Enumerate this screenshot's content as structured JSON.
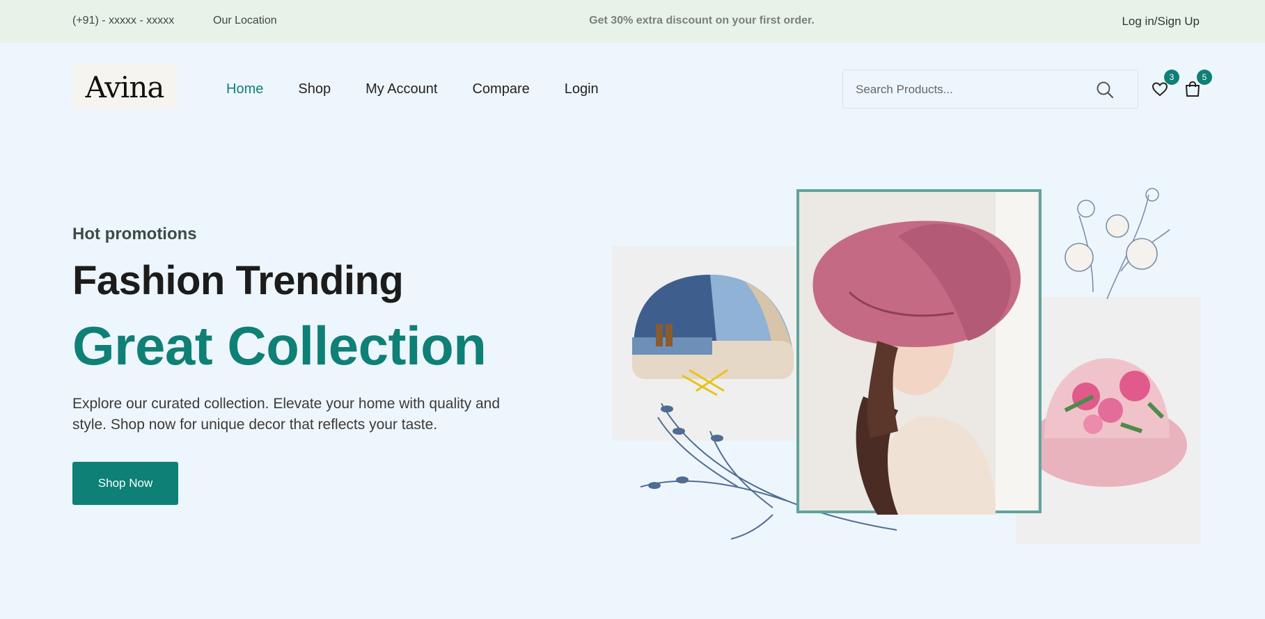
{
  "topbar": {
    "phone": "(+91) - xxxxx - xxxxx",
    "location": "Our Location",
    "promo": "Get 30% extra discount on your first order.",
    "login": "Log in/Sign Up"
  },
  "header": {
    "logo": "Avina",
    "nav": [
      {
        "label": "Home",
        "active": true
      },
      {
        "label": "Shop"
      },
      {
        "label": "My Account"
      },
      {
        "label": "Compare"
      },
      {
        "label": "Login"
      }
    ],
    "search": {
      "placeholder": "Search Products...",
      "icon": "search-icon"
    },
    "wishlist": {
      "count": "3",
      "icon": "heart-icon"
    },
    "cart": {
      "count": "5",
      "icon": "shopping-bag-icon"
    }
  },
  "hero": {
    "eyebrow": "Hot promotions",
    "title": "Fashion Trending",
    "subtitle": "Great Collection",
    "description": "Explore our curated collection. Elevate your home with quality and style. Shop now for unique decor that reflects your taste.",
    "cta": "Shop Now"
  },
  "colors": {
    "accent": "#0e8076",
    "background": "#eef6fd",
    "topbar": "#e7f3e9"
  }
}
